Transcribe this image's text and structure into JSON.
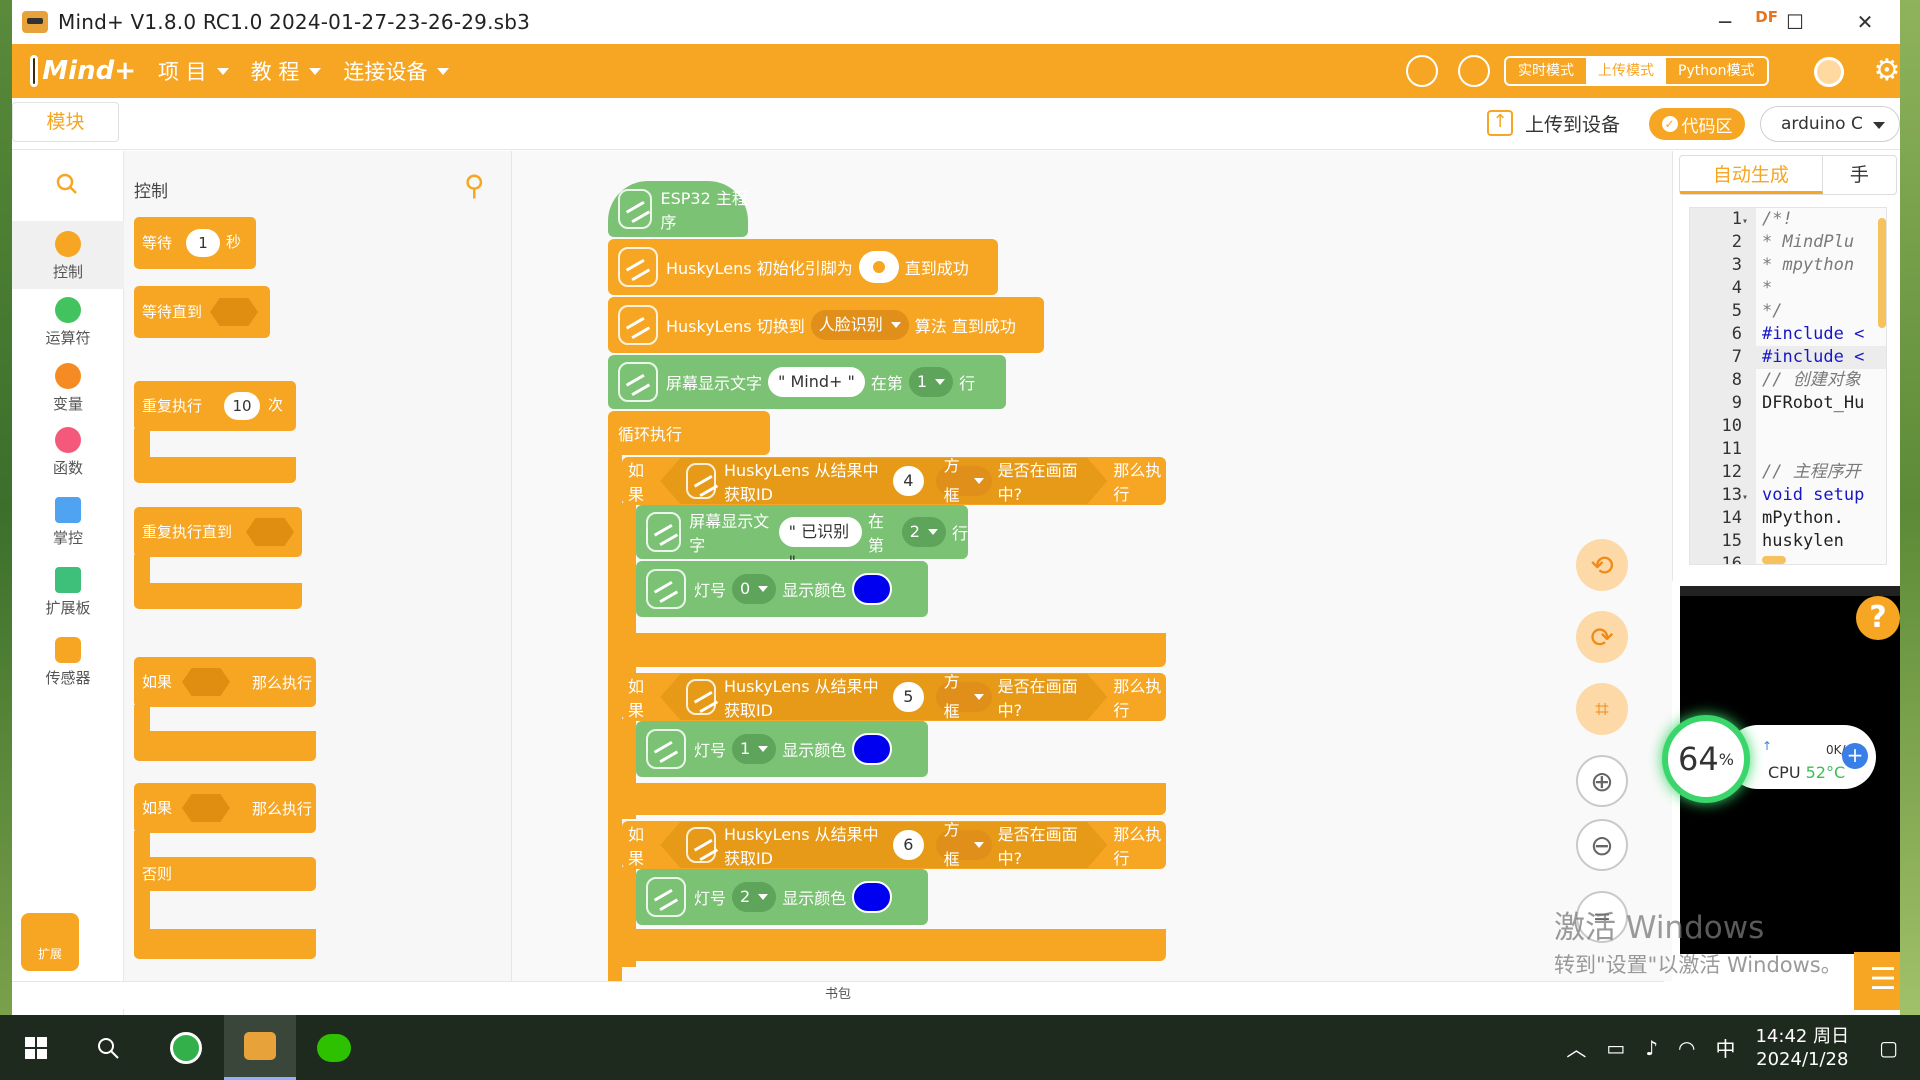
{
  "window": {
    "title": "Mind+ V1.8.0 RC1.0   2024-01-27-23-26-29.sb3",
    "badge": "DF"
  },
  "menu": {
    "logo": "Mind+",
    "items": [
      "项 目",
      "教 程",
      "连接设备"
    ],
    "modes": [
      "实时模式",
      "上传模式",
      "Python模式"
    ],
    "active_mode_index": 1
  },
  "toolbar": {
    "blocks_tab": "模块",
    "upload_label": "上传到设备",
    "code_toggle": "代码区",
    "device": "arduino C"
  },
  "categories": [
    {
      "label": "控制",
      "color": "#f6a623"
    },
    {
      "label": "运算符",
      "color": "#43c35f"
    },
    {
      "label": "变量",
      "color": "#f68a23"
    },
    {
      "label": "函数",
      "color": "#f4587a"
    },
    {
      "label": "掌控",
      "color": "#4fa3f0"
    },
    {
      "label": "扩展板",
      "color": "#3fc07a"
    },
    {
      "label": "传感器",
      "color": "#f6a623"
    }
  ],
  "extension_label": "扩展",
  "palette": {
    "title": "控制",
    "wait": {
      "label": "等待",
      "value": "1",
      "unit": "秒"
    },
    "wait_until": "等待直到",
    "repeat": {
      "label": "重复执行",
      "value": "10",
      "unit": "次"
    },
    "repeat_until": "重复执行直到",
    "if_then": {
      "label": "如果",
      "then": "那么执行"
    },
    "if_else": {
      "label": "如果",
      "then": "那么执行",
      "else": "否则"
    }
  },
  "workspace": {
    "hat": "ESP32 主程序",
    "husky_init": {
      "text": "HuskyLens 初始化引脚为",
      "suffix": "直到成功"
    },
    "husky_switch": {
      "text": "HuskyLens 切换到",
      "algorithm": "人脸识别",
      "suffix": "算法 直到成功"
    },
    "screen_text_1": {
      "label": "屏幕显示文字",
      "value": "\" Mind+ \"",
      "at": "在第",
      "line": "1",
      "row": "行"
    },
    "loop_label": "循环执行",
    "if_blocks": [
      {
        "if_label": "如果",
        "query": "HuskyLens 从结果中获取ID",
        "id": "4",
        "shape": "方框",
        "tail": "是否在画面中?",
        "then": "那么执行",
        "screen": {
          "label": "屏幕显示文字",
          "value": "\" 已识别 \"",
          "at": "在第",
          "line": "2",
          "row": "行"
        },
        "led": {
          "label": "灯号",
          "index": "0",
          "color_label": "显示颜色",
          "color": "#0000f0"
        }
      },
      {
        "if_label": "如果",
        "query": "HuskyLens 从结果中获取ID",
        "id": "5",
        "shape": "方框",
        "tail": "是否在画面中?",
        "then": "那么执行",
        "led": {
          "label": "灯号",
          "index": "1",
          "color_label": "显示颜色",
          "color": "#0000f0"
        }
      },
      {
        "if_label": "如果",
        "query": "HuskyLens 从结果中获取ID",
        "id": "6",
        "shape": "方框",
        "tail": "是否在画面中?",
        "then": "那么执行",
        "led": {
          "label": "灯号",
          "index": "2",
          "color_label": "显示颜色",
          "color": "#0000f0"
        }
      }
    ]
  },
  "code_panel": {
    "tabs": [
      "自动生成",
      "手"
    ],
    "lines": [
      {
        "n": "1",
        "fold": true,
        "text": "/*!",
        "kind": "comment"
      },
      {
        "n": "2",
        "fold": false,
        "text": " * MindPlu",
        "kind": "comment"
      },
      {
        "n": "3",
        "fold": false,
        "text": " * mpython",
        "kind": "comment"
      },
      {
        "n": "4",
        "fold": false,
        "text": " *",
        "kind": "comment"
      },
      {
        "n": "5",
        "fold": false,
        "text": " */",
        "kind": "comment"
      },
      {
        "n": "6",
        "fold": false,
        "text": "#include <",
        "kind": "kw"
      },
      {
        "n": "7",
        "fold": false,
        "text": "#include <",
        "kind": "kw"
      },
      {
        "n": "8",
        "fold": false,
        "text": "// 创建对象",
        "kind": "comment"
      },
      {
        "n": "9",
        "fold": false,
        "text": "DFRobot_Hu",
        "kind": "plain"
      },
      {
        "n": "10",
        "fold": false,
        "text": "",
        "kind": "plain"
      },
      {
        "n": "11",
        "fold": false,
        "text": "",
        "kind": "plain"
      },
      {
        "n": "12",
        "fold": false,
        "text": "// 主程序开",
        "kind": "comment"
      },
      {
        "n": "13",
        "fold": true,
        "text": "void setup",
        "kind": "kw"
      },
      {
        "n": "14",
        "fold": false,
        "text": "  mPython.",
        "kind": "plain"
      },
      {
        "n": "15",
        "fold": false,
        "text": "  huskylen",
        "kind": "plain"
      },
      {
        "n": "16",
        "fold": false,
        "text": "",
        "kind": "plain"
      }
    ]
  },
  "cpu_widget": {
    "percent": "64",
    "percent_sign": "%",
    "speed": "0K/s",
    "label": "CPU",
    "temp": "52°C"
  },
  "watermark": {
    "line1": "激活 Windows",
    "line2": "转到\"设置\"以激活 Windows。"
  },
  "backpack": "书包",
  "taskbar": {
    "ime": "中",
    "time": "14:42 周日",
    "date": "2024/1/28"
  }
}
